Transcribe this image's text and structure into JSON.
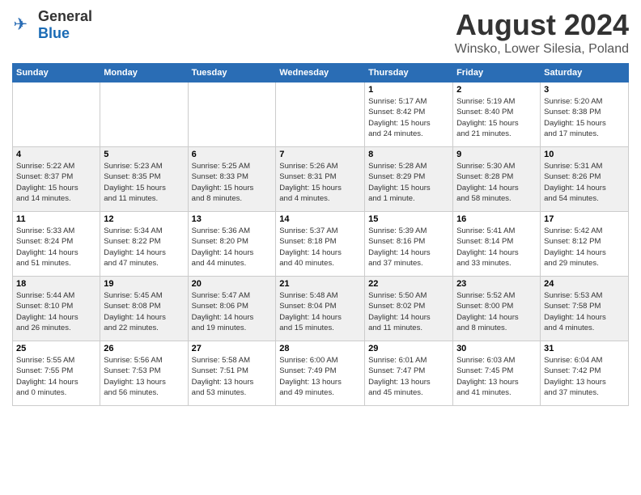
{
  "header": {
    "logo": {
      "general": "General",
      "blue": "Blue"
    },
    "title": "August 2024",
    "location": "Winsko, Lower Silesia, Poland"
  },
  "calendar": {
    "days_of_week": [
      "Sunday",
      "Monday",
      "Tuesday",
      "Wednesday",
      "Thursday",
      "Friday",
      "Saturday"
    ],
    "weeks": [
      [
        {
          "day": "",
          "info": ""
        },
        {
          "day": "",
          "info": ""
        },
        {
          "day": "",
          "info": ""
        },
        {
          "day": "",
          "info": ""
        },
        {
          "day": "1",
          "info": "Sunrise: 5:17 AM\nSunset: 8:42 PM\nDaylight: 15 hours\nand 24 minutes."
        },
        {
          "day": "2",
          "info": "Sunrise: 5:19 AM\nSunset: 8:40 PM\nDaylight: 15 hours\nand 21 minutes."
        },
        {
          "day": "3",
          "info": "Sunrise: 5:20 AM\nSunset: 8:38 PM\nDaylight: 15 hours\nand 17 minutes."
        }
      ],
      [
        {
          "day": "4",
          "info": "Sunrise: 5:22 AM\nSunset: 8:37 PM\nDaylight: 15 hours\nand 14 minutes."
        },
        {
          "day": "5",
          "info": "Sunrise: 5:23 AM\nSunset: 8:35 PM\nDaylight: 15 hours\nand 11 minutes."
        },
        {
          "day": "6",
          "info": "Sunrise: 5:25 AM\nSunset: 8:33 PM\nDaylight: 15 hours\nand 8 minutes."
        },
        {
          "day": "7",
          "info": "Sunrise: 5:26 AM\nSunset: 8:31 PM\nDaylight: 15 hours\nand 4 minutes."
        },
        {
          "day": "8",
          "info": "Sunrise: 5:28 AM\nSunset: 8:29 PM\nDaylight: 15 hours\nand 1 minute."
        },
        {
          "day": "9",
          "info": "Sunrise: 5:30 AM\nSunset: 8:28 PM\nDaylight: 14 hours\nand 58 minutes."
        },
        {
          "day": "10",
          "info": "Sunrise: 5:31 AM\nSunset: 8:26 PM\nDaylight: 14 hours\nand 54 minutes."
        }
      ],
      [
        {
          "day": "11",
          "info": "Sunrise: 5:33 AM\nSunset: 8:24 PM\nDaylight: 14 hours\nand 51 minutes."
        },
        {
          "day": "12",
          "info": "Sunrise: 5:34 AM\nSunset: 8:22 PM\nDaylight: 14 hours\nand 47 minutes."
        },
        {
          "day": "13",
          "info": "Sunrise: 5:36 AM\nSunset: 8:20 PM\nDaylight: 14 hours\nand 44 minutes."
        },
        {
          "day": "14",
          "info": "Sunrise: 5:37 AM\nSunset: 8:18 PM\nDaylight: 14 hours\nand 40 minutes."
        },
        {
          "day": "15",
          "info": "Sunrise: 5:39 AM\nSunset: 8:16 PM\nDaylight: 14 hours\nand 37 minutes."
        },
        {
          "day": "16",
          "info": "Sunrise: 5:41 AM\nSunset: 8:14 PM\nDaylight: 14 hours\nand 33 minutes."
        },
        {
          "day": "17",
          "info": "Sunrise: 5:42 AM\nSunset: 8:12 PM\nDaylight: 14 hours\nand 29 minutes."
        }
      ],
      [
        {
          "day": "18",
          "info": "Sunrise: 5:44 AM\nSunset: 8:10 PM\nDaylight: 14 hours\nand 26 minutes."
        },
        {
          "day": "19",
          "info": "Sunrise: 5:45 AM\nSunset: 8:08 PM\nDaylight: 14 hours\nand 22 minutes."
        },
        {
          "day": "20",
          "info": "Sunrise: 5:47 AM\nSunset: 8:06 PM\nDaylight: 14 hours\nand 19 minutes."
        },
        {
          "day": "21",
          "info": "Sunrise: 5:48 AM\nSunset: 8:04 PM\nDaylight: 14 hours\nand 15 minutes."
        },
        {
          "day": "22",
          "info": "Sunrise: 5:50 AM\nSunset: 8:02 PM\nDaylight: 14 hours\nand 11 minutes."
        },
        {
          "day": "23",
          "info": "Sunrise: 5:52 AM\nSunset: 8:00 PM\nDaylight: 14 hours\nand 8 minutes."
        },
        {
          "day": "24",
          "info": "Sunrise: 5:53 AM\nSunset: 7:58 PM\nDaylight: 14 hours\nand 4 minutes."
        }
      ],
      [
        {
          "day": "25",
          "info": "Sunrise: 5:55 AM\nSunset: 7:55 PM\nDaylight: 14 hours\nand 0 minutes."
        },
        {
          "day": "26",
          "info": "Sunrise: 5:56 AM\nSunset: 7:53 PM\nDaylight: 13 hours\nand 56 minutes."
        },
        {
          "day": "27",
          "info": "Sunrise: 5:58 AM\nSunset: 7:51 PM\nDaylight: 13 hours\nand 53 minutes."
        },
        {
          "day": "28",
          "info": "Sunrise: 6:00 AM\nSunset: 7:49 PM\nDaylight: 13 hours\nand 49 minutes."
        },
        {
          "day": "29",
          "info": "Sunrise: 6:01 AM\nSunset: 7:47 PM\nDaylight: 13 hours\nand 45 minutes."
        },
        {
          "day": "30",
          "info": "Sunrise: 6:03 AM\nSunset: 7:45 PM\nDaylight: 13 hours\nand 41 minutes."
        },
        {
          "day": "31",
          "info": "Sunrise: 6:04 AM\nSunset: 7:42 PM\nDaylight: 13 hours\nand 37 minutes."
        }
      ]
    ]
  }
}
